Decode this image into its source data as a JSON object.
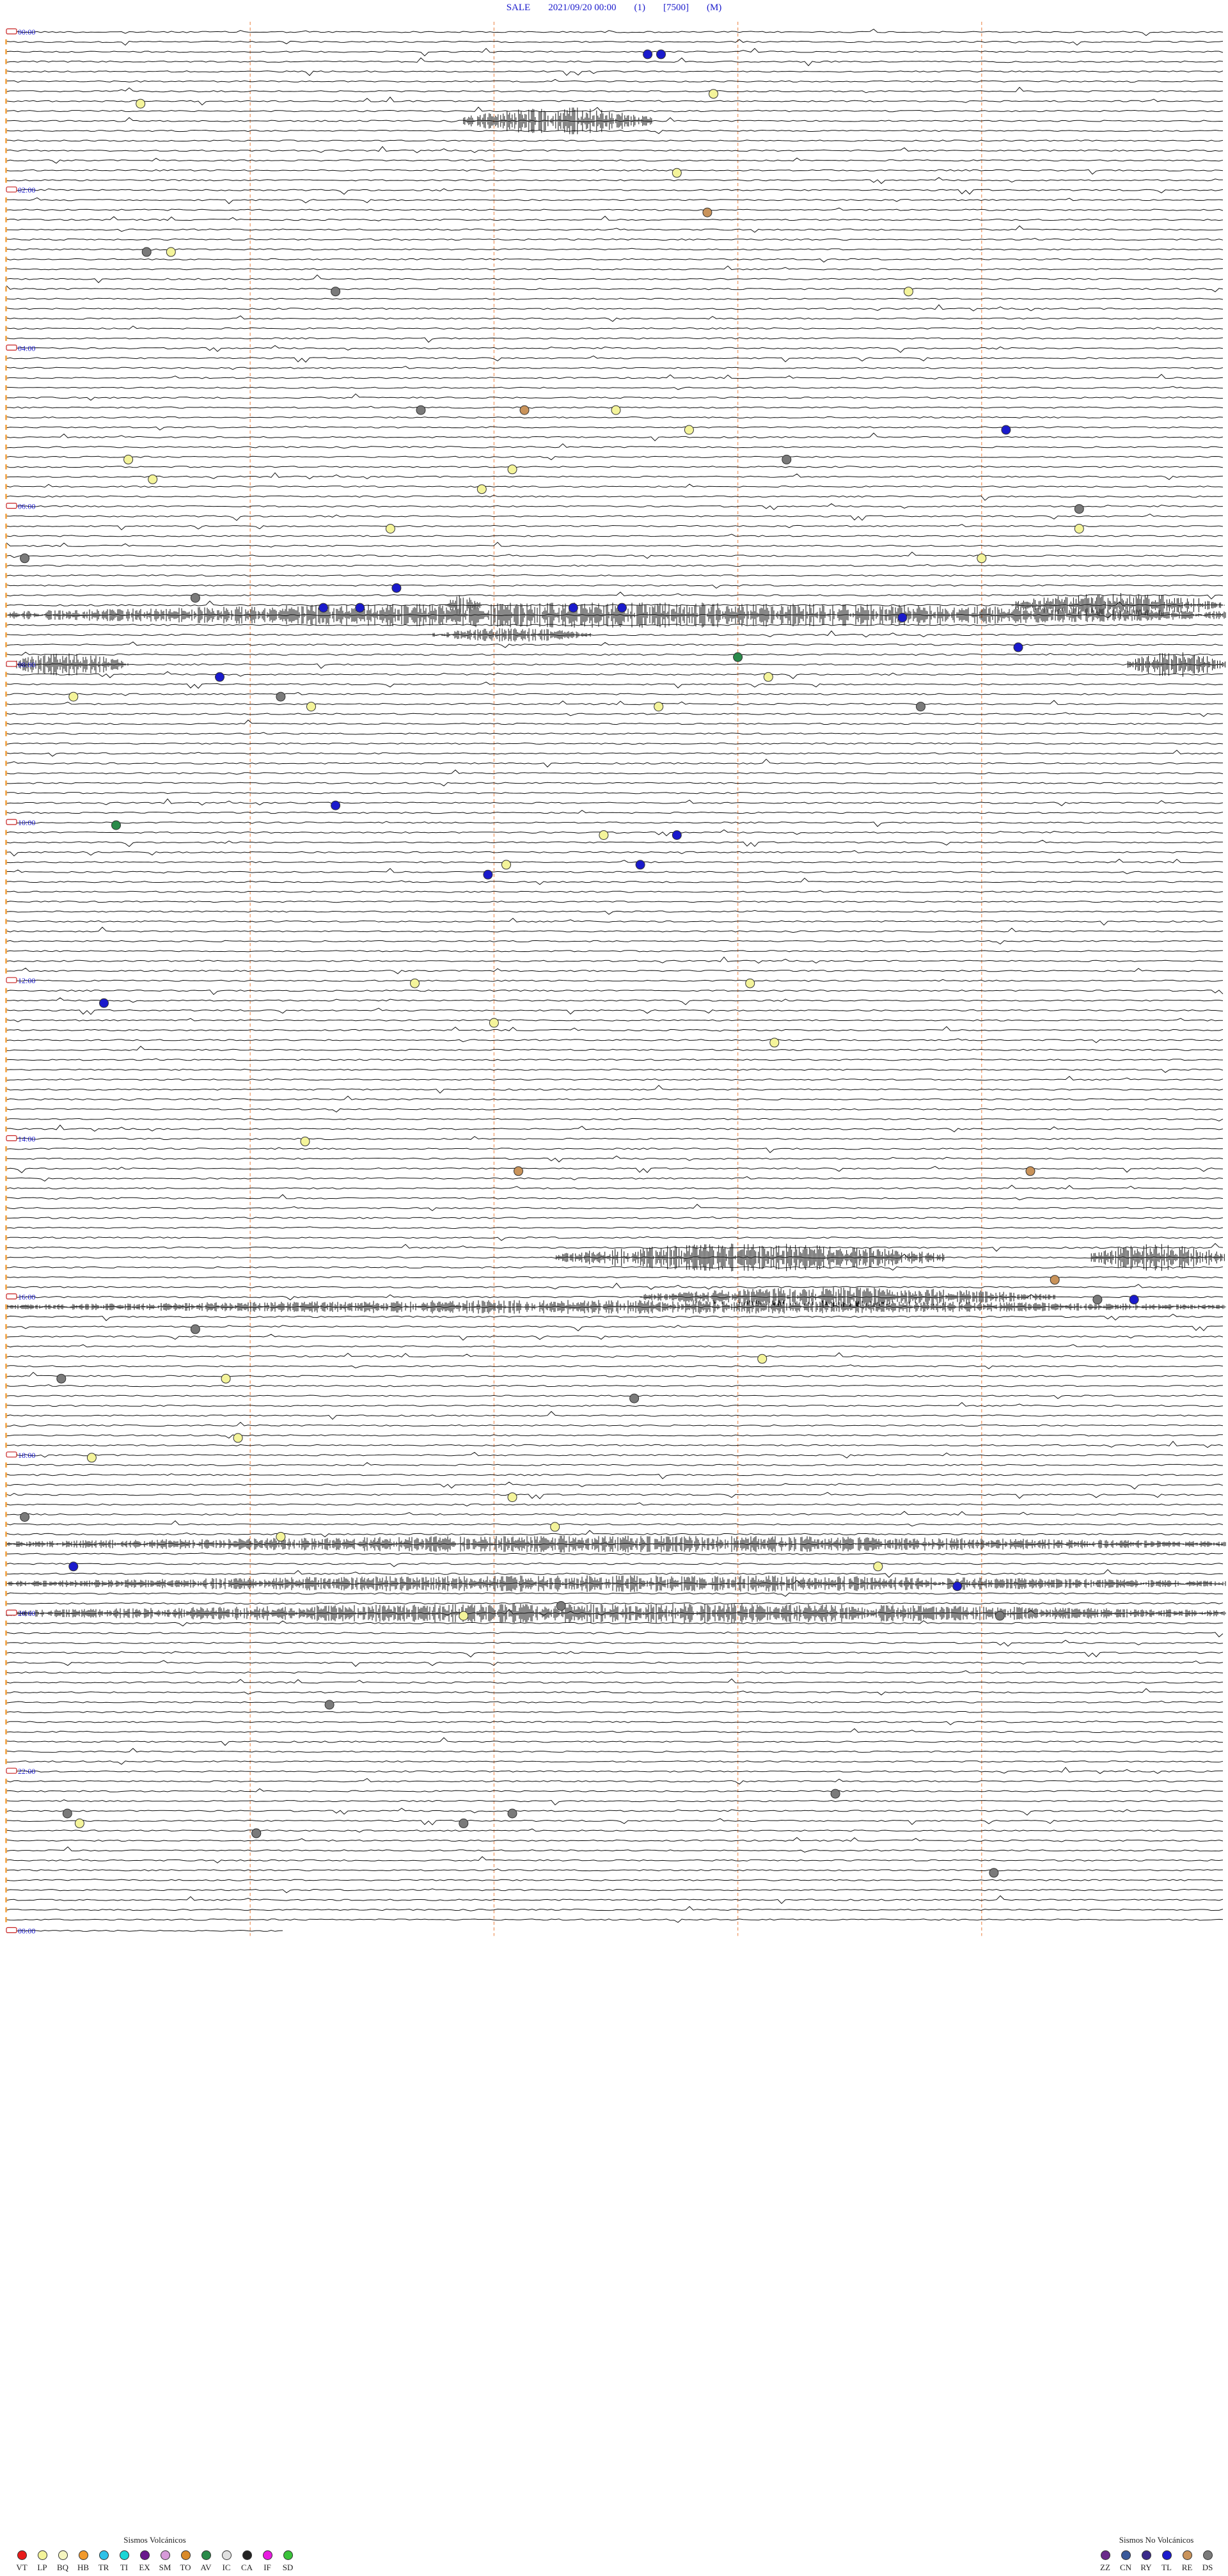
{
  "header": {
    "station": "SALE",
    "datetime": "2021/09/20 00:00",
    "channel": "(1)",
    "scale": "[7500]",
    "mode": "(M)"
  },
  "chart_data": {
    "type": "scatter",
    "description_type": "helicorder",
    "hour_labels": [
      "00:00",
      "02:00",
      "04:00",
      "06:00",
      "08:00",
      "10:00",
      "12:00",
      "14:00",
      "16:00",
      "18:00",
      "20:00",
      "22:00",
      "00:00"
    ],
    "events": [
      {
        "hour": 0.3,
        "minute": 52.6,
        "class": "TL"
      },
      {
        "hour": 0.3,
        "minute": 53.7,
        "class": "TL"
      },
      {
        "hour": 0.7,
        "minute": 58.0,
        "class": "LP"
      },
      {
        "hour": 0.92,
        "minute": 11.0,
        "class": "LP"
      },
      {
        "hour": 1.75,
        "minute": 55.0,
        "class": "LP"
      },
      {
        "hour": 2.3,
        "minute": 57.5,
        "class": "RE"
      },
      {
        "hour": 2.7,
        "minute": 11.5,
        "class": "DS"
      },
      {
        "hour": 2.7,
        "minute": 13.5,
        "class": "LP"
      },
      {
        "hour": 3.25,
        "minute": 27.0,
        "class": "DS"
      },
      {
        "hour": 3.25,
        "minute": 74.0,
        "class": "LP"
      },
      {
        "hour": 4.7,
        "minute": 34.0,
        "class": "DS"
      },
      {
        "hour": 4.7,
        "minute": 42.5,
        "class": "RE"
      },
      {
        "hour": 4.7,
        "minute": 50.0,
        "class": "LP"
      },
      {
        "hour": 5.0,
        "minute": 82.0,
        "class": "TL"
      },
      {
        "hour": 5.0,
        "minute": 56.0,
        "class": "LP"
      },
      {
        "hour": 5.33,
        "minute": 10.0,
        "class": "LP"
      },
      {
        "hour": 5.33,
        "minute": 64.0,
        "class": "DS"
      },
      {
        "hour": 5.45,
        "minute": 41.5,
        "class": "LP"
      },
      {
        "hour": 5.63,
        "minute": 12.0,
        "class": "LP"
      },
      {
        "hour": 5.75,
        "minute": 39.0,
        "class": "LP"
      },
      {
        "hour": 6.05,
        "minute": 88.0,
        "class": "DS"
      },
      {
        "hour": 6.25,
        "minute": 31.5,
        "class": "LP"
      },
      {
        "hour": 6.25,
        "minute": 88.0,
        "class": "LP"
      },
      {
        "hour": 6.65,
        "minute": 1.5,
        "class": "DS"
      },
      {
        "hour": 6.65,
        "minute": 80.0,
        "class": "LP"
      },
      {
        "hour": 7.0,
        "minute": 32.0,
        "class": "TL"
      },
      {
        "hour": 7.1,
        "minute": 15.5,
        "class": "DS"
      },
      {
        "hour": 7.25,
        "minute": 26.0,
        "class": "TL"
      },
      {
        "hour": 7.25,
        "minute": 29.0,
        "class": "TL"
      },
      {
        "hour": 7.25,
        "minute": 46.5,
        "class": "TL"
      },
      {
        "hour": 7.25,
        "minute": 50.5,
        "class": "TL"
      },
      {
        "hour": 7.4,
        "minute": 73.5,
        "class": "TL"
      },
      {
        "hour": 7.8,
        "minute": 83.0,
        "class": "TL"
      },
      {
        "hour": 7.85,
        "minute": 60.0,
        "class": "AV"
      },
      {
        "hour": 8.15,
        "minute": 17.5,
        "class": "TL"
      },
      {
        "hour": 8.15,
        "minute": 62.5,
        "class": "LP"
      },
      {
        "hour": 8.4,
        "minute": 5.5,
        "class": "LP"
      },
      {
        "hour": 8.4,
        "minute": 22.5,
        "class": "DS"
      },
      {
        "hour": 8.45,
        "minute": 53.5,
        "class": "LP"
      },
      {
        "hour": 8.45,
        "minute": 75.0,
        "class": "DS"
      },
      {
        "hour": 8.55,
        "minute": 25.0,
        "class": "LP"
      },
      {
        "hour": 9.7,
        "minute": 27.0,
        "class": "TL"
      },
      {
        "hour": 9.95,
        "minute": 9.0,
        "class": "AV"
      },
      {
        "hour": 10.15,
        "minute": 49.0,
        "class": "LP"
      },
      {
        "hour": 10.15,
        "minute": 55.0,
        "class": "TL"
      },
      {
        "hour": 10.45,
        "minute": 41.0,
        "class": "LP"
      },
      {
        "hour": 10.45,
        "minute": 52.0,
        "class": "TL"
      },
      {
        "hour": 10.65,
        "minute": 39.5,
        "class": "TL"
      },
      {
        "hour": 12.2,
        "minute": 8.0,
        "class": "TL"
      },
      {
        "hour": 12.05,
        "minute": 33.5,
        "class": "LP"
      },
      {
        "hour": 12.05,
        "minute": 61.0,
        "class": "LP"
      },
      {
        "hour": 12.45,
        "minute": 40.0,
        "class": "LP"
      },
      {
        "hour": 12.75,
        "minute": 63.0,
        "class": "LP"
      },
      {
        "hour": 14.0,
        "minute": 24.5,
        "class": "LP"
      },
      {
        "hour": 14.4,
        "minute": 42.0,
        "class": "RE"
      },
      {
        "hour": 14.4,
        "minute": 84.0,
        "class": "RE"
      },
      {
        "hour": 15.75,
        "minute": 86.0,
        "class": "RE"
      },
      {
        "hour": 16.0,
        "minute": 89.5,
        "class": "DS"
      },
      {
        "hour": 16.05,
        "minute": 92.5,
        "class": "TL"
      },
      {
        "hour": 16.4,
        "minute": 15.5,
        "class": "DS"
      },
      {
        "hour": 16.8,
        "minute": 62.0,
        "class": "LP"
      },
      {
        "hour": 16.95,
        "minute": 4.5,
        "class": "DS"
      },
      {
        "hour": 17.0,
        "minute": 18.0,
        "class": "LP"
      },
      {
        "hour": 17.25,
        "minute": 51.5,
        "class": "DS"
      },
      {
        "hour": 17.75,
        "minute": 19.0,
        "class": "LP"
      },
      {
        "hour": 17.95,
        "minute": 7.0,
        "class": "LP"
      },
      {
        "hour": 18.45,
        "minute": 41.5,
        "class": "LP"
      },
      {
        "hour": 18.7,
        "minute": 1.5,
        "class": "DS"
      },
      {
        "hour": 18.9,
        "minute": 45.0,
        "class": "LP"
      },
      {
        "hour": 19.05,
        "minute": 22.5,
        "class": "LP"
      },
      {
        "hour": 19.35,
        "minute": 5.5,
        "class": "TL"
      },
      {
        "hour": 19.35,
        "minute": 71.5,
        "class": "LP"
      },
      {
        "hour": 19.6,
        "minute": 78.0,
        "class": "TL"
      },
      {
        "hour": 19.85,
        "minute": 45.5,
        "class": "DS"
      },
      {
        "hour": 19.95,
        "minute": 37.5,
        "class": "LP"
      },
      {
        "hour": 20.0,
        "minute": 81.5,
        "class": "DS"
      },
      {
        "hour": 21.15,
        "minute": 26.5,
        "class": "DS"
      },
      {
        "hour": 22.25,
        "minute": 68.0,
        "class": "DS"
      },
      {
        "hour": 22.55,
        "minute": 5.0,
        "class": "DS"
      },
      {
        "hour": 22.65,
        "minute": 6.0,
        "class": "LP"
      },
      {
        "hour": 22.55,
        "minute": 41.5,
        "class": "DS"
      },
      {
        "hour": 22.65,
        "minute": 37.5,
        "class": "DS"
      },
      {
        "hour": 22.75,
        "minute": 20.5,
        "class": "TL"
      },
      {
        "hour": 22.8,
        "minute": 20.5,
        "class": "DS"
      },
      {
        "hour": 23.25,
        "minute": 81.0,
        "class": "DS"
      }
    ],
    "bursts": [
      {
        "trace": 9,
        "start": 37.5,
        "end": 53.0,
        "amp": 1.0
      },
      {
        "trace": 58,
        "start": 36.0,
        "end": 39.0,
        "amp": 0.7
      },
      {
        "trace": 58,
        "start": 82.5,
        "end": 100.0,
        "amp": 0.9
      },
      {
        "trace": 59,
        "start": 0.0,
        "end": 100.0,
        "amp": 0.9
      },
      {
        "trace": 61,
        "start": 35.0,
        "end": 48.0,
        "amp": 0.5
      },
      {
        "trace": 64,
        "start": 0.0,
        "end": 10.0,
        "amp": 0.8
      },
      {
        "trace": 64,
        "start": 92.0,
        "end": 100.0,
        "amp": 0.9
      },
      {
        "trace": 124,
        "start": 45.0,
        "end": 77.0,
        "amp": 1.0
      },
      {
        "trace": 124,
        "start": 89.0,
        "end": 100.0,
        "amp": 1.0
      },
      {
        "trace": 128,
        "start": 52.0,
        "end": 86.0,
        "amp": 0.7
      },
      {
        "trace": 129,
        "start": 0.0,
        "end": 100.0,
        "amp": 0.5
      },
      {
        "trace": 153,
        "start": 0.0,
        "end": 100.0,
        "amp": 0.6
      },
      {
        "trace": 157,
        "start": 0.0,
        "end": 100.0,
        "amp": 0.6
      },
      {
        "trace": 160,
        "start": 0.0,
        "end": 100.0,
        "amp": 0.7
      }
    ],
    "legend_volcanic_title": "Sismos Volcánicos",
    "legend_volcanic": [
      {
        "code": "VT",
        "color": "#e81b1b"
      },
      {
        "code": "LP",
        "color": "#f4f49a"
      },
      {
        "code": "BQ",
        "color": "#f5f5c0"
      },
      {
        "code": "HB",
        "color": "#f29a2e"
      },
      {
        "code": "TR",
        "color": "#2ec1e8"
      },
      {
        "code": "TI",
        "color": "#19d6d6"
      },
      {
        "code": "EX",
        "color": "#6a1a8c"
      },
      {
        "code": "SM",
        "color": "#d79ad9"
      },
      {
        "code": "TO",
        "color": "#d98a2a"
      },
      {
        "code": "AV",
        "color": "#2a8a4a"
      },
      {
        "code": "IC",
        "color": "#e0e0e0"
      },
      {
        "code": "CA",
        "color": "#222222"
      },
      {
        "code": "IF",
        "color": "#e81be0"
      },
      {
        "code": "SD",
        "color": "#3ac23a"
      }
    ],
    "legend_nonvolcanic_title": "Sismos No Volcánicos",
    "legend_nonvolcanic": [
      {
        "code": "ZZ",
        "color": "#6a2a8a"
      },
      {
        "code": "CN",
        "color": "#3a5a9a"
      },
      {
        "code": "RY",
        "color": "#3a2a8a"
      },
      {
        "code": "TL",
        "color": "#1a1acc"
      },
      {
        "code": "RE",
        "color": "#c9935a"
      },
      {
        "code": "DS",
        "color": "#7a7a7a"
      }
    ]
  }
}
